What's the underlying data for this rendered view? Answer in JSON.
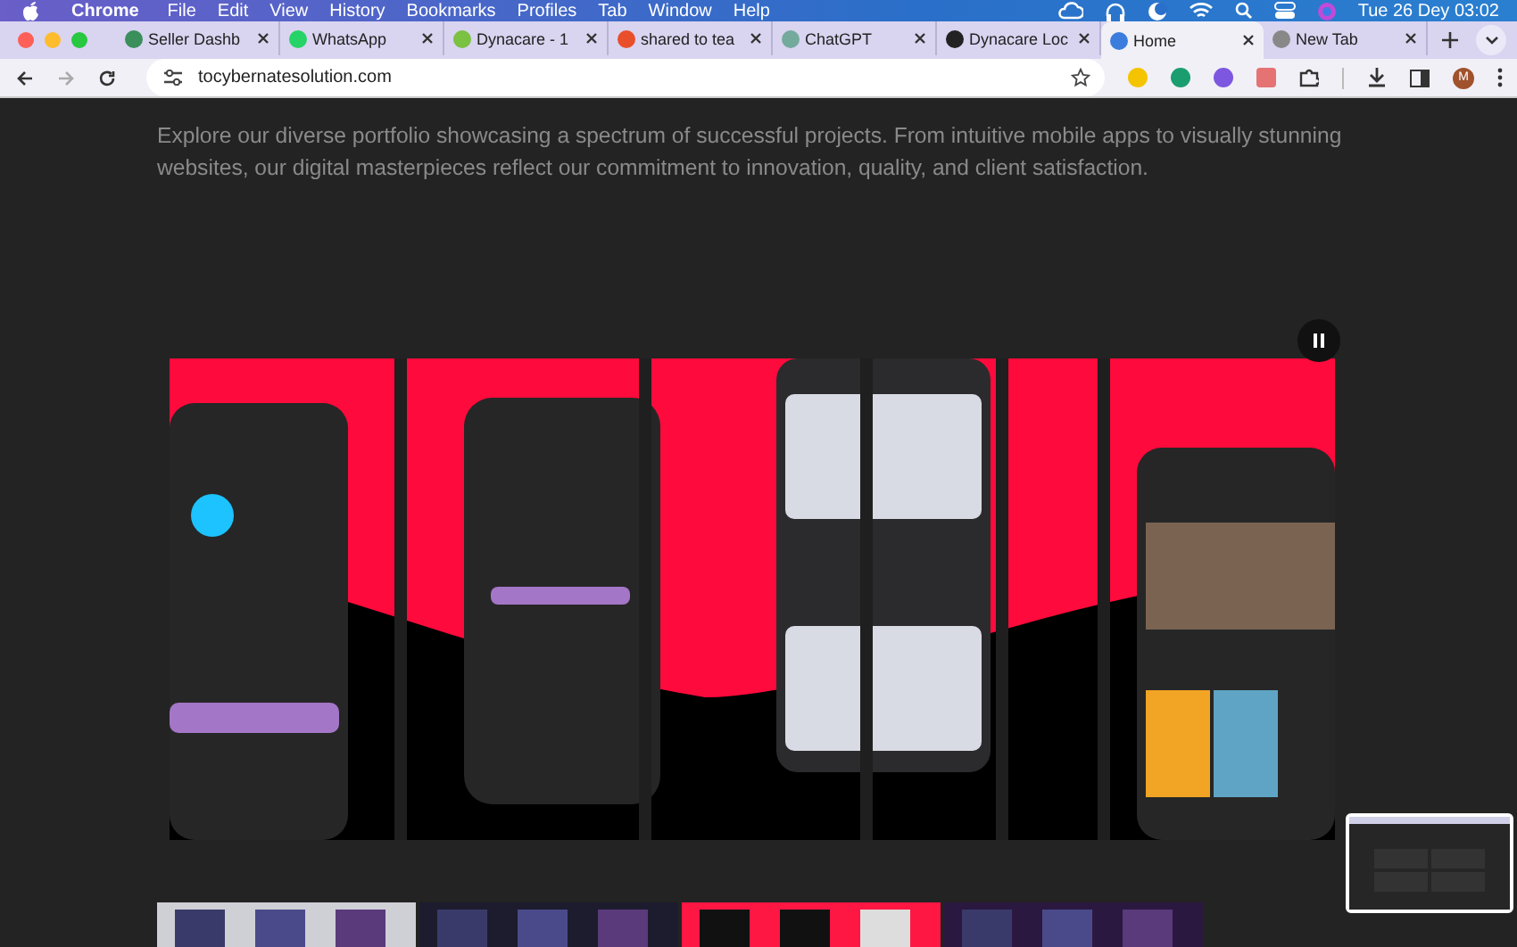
{
  "menu_bar": {
    "app": "Chrome",
    "items": [
      "File",
      "Edit",
      "View",
      "History",
      "Bookmarks",
      "Profiles",
      "Tab",
      "Window",
      "Help"
    ],
    "clock": "Tue 26 Dey  03:02"
  },
  "tabs": [
    {
      "label": "Seller Dashb",
      "selected": false
    },
    {
      "label": "WhatsApp",
      "selected": false
    },
    {
      "label": "Dynacare - 1",
      "selected": false
    },
    {
      "label": "shared to tea",
      "selected": false
    },
    {
      "label": "ChatGPT",
      "selected": false
    },
    {
      "label": "Dynacare Loc",
      "selected": false
    },
    {
      "label": "Home",
      "selected": true
    },
    {
      "label": "New Tab",
      "selected": false
    }
  ],
  "address_bar": {
    "url": "tocybernatesolution.com"
  },
  "profile_initial": "M",
  "page": {
    "intro": "Explore our diverse portfolio showcasing a spectrum of successful projects. From intuitive mobile apps to visually stunning websites, our digital masterpieces reflect our commitment to innovation, quality, and client satisfaction.",
    "showcase": {
      "kind": "picture",
      "playing": true
    },
    "thumbnails": [
      {
        "kind": "picture"
      },
      {
        "kind": "picture"
      },
      {
        "kind": "picture"
      },
      {
        "kind": "picture"
      }
    ]
  }
}
